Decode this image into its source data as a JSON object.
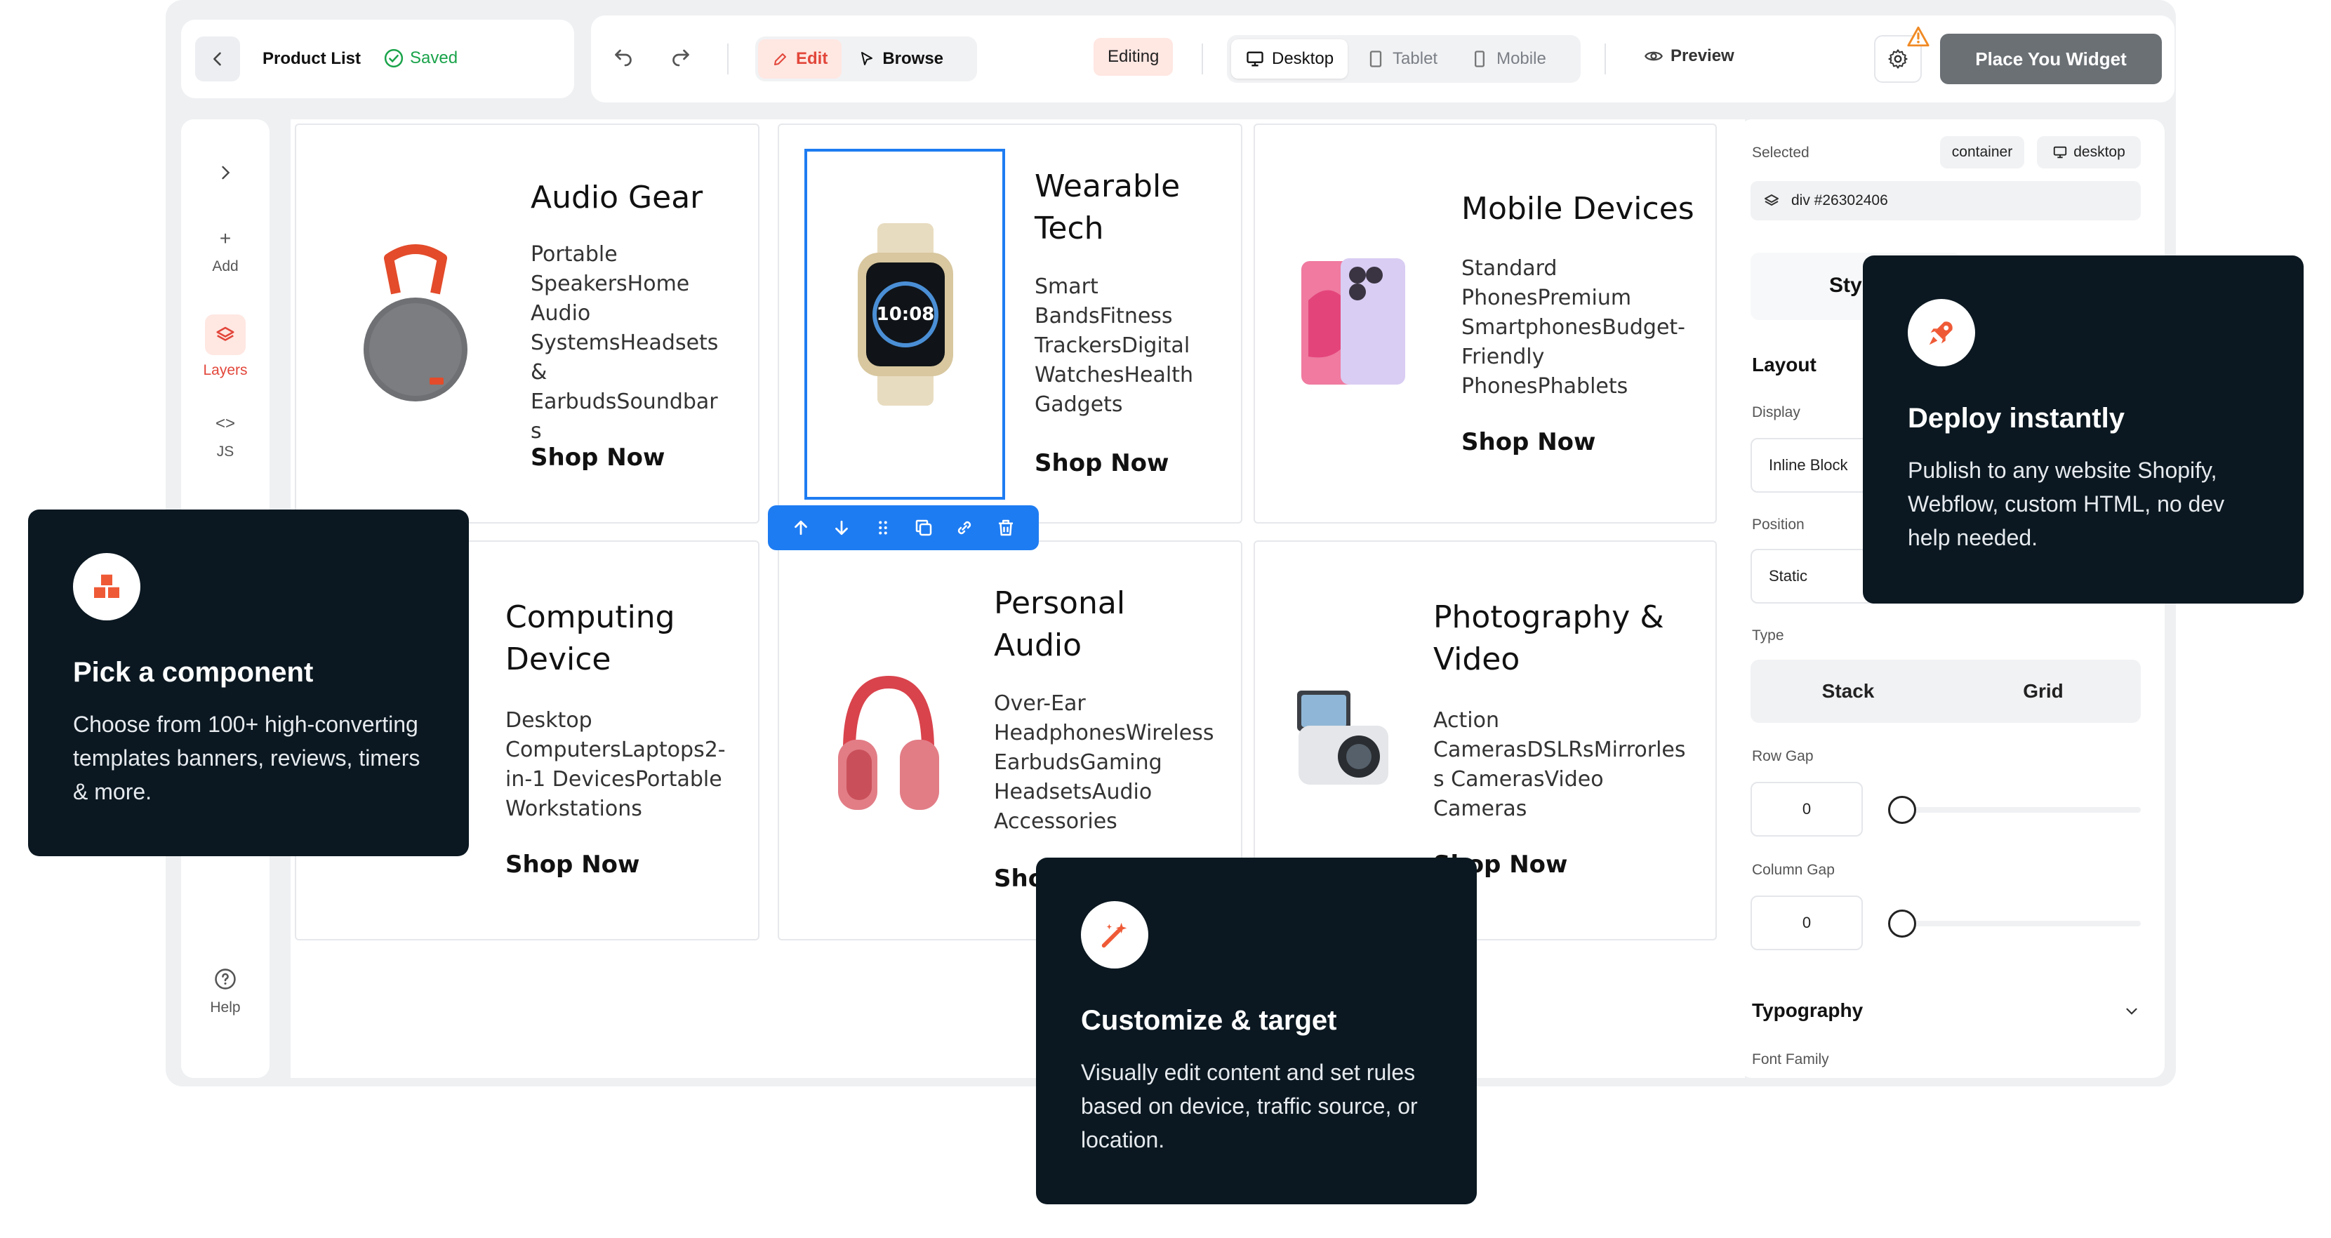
{
  "header": {
    "page_title": "Product List",
    "saved_label": "Saved",
    "edit_label": "Edit",
    "browse_label": "Browse",
    "editing_badge": "Editing",
    "desktop_label": "Desktop",
    "tablet_label": "Tablet",
    "mobile_label": "Mobile",
    "preview_label": "Preview",
    "cta_label": "Place You Widget"
  },
  "rail": {
    "add_label": "Add",
    "layers_label": "Layers",
    "js_label": "JS",
    "help_label": "Help"
  },
  "cards": [
    {
      "title": "Audio Gear",
      "desc": "Portable SpeakersHome Audio SystemsHeadsets & EarbudsSoundbars",
      "cta": "Shop Now"
    },
    {
      "title": "Wearable Tech",
      "desc": "Smart BandsFitness TrackersDigital WatchesHealth Gadgets",
      "cta": "Shop Now"
    },
    {
      "title": "Mobile Devices",
      "desc": "Standard PhonesPremium SmartphonesBudget-Friendly PhonesPhablets",
      "cta": "Shop Now"
    },
    {
      "title": "Computing Device",
      "desc": "Desktop ComputersLaptops2-in-1 DevicesPortable Workstations",
      "cta": "Shop Now"
    },
    {
      "title": "Personal Audio",
      "desc": "Over-Ear HeadphonesWireless EarbudsGaming HeadsetsAudio Accessories",
      "cta": "Shop Now"
    },
    {
      "title": "Photography & Video",
      "desc": "Action CamerasDSLRsMirrorless CamerasVideo Cameras",
      "cta": "Shop Now"
    }
  ],
  "panel": {
    "selected_label": "Selected",
    "container_pill": "container",
    "desktop_pill": "desktop",
    "element_id": "div #26302406",
    "style_tab": "Sty",
    "layout_heading": "Layout",
    "display_label": "Display",
    "display_value": "Inline Block",
    "position_label": "Position",
    "position_value": "Static",
    "type_label": "Type",
    "stack_label": "Stack",
    "grid_label": "Grid",
    "row_gap_label": "Row Gap",
    "row_gap_value": "0",
    "column_gap_label": "Column Gap",
    "column_gap_value": "0",
    "typography_heading": "Typography",
    "font_family_label": "Font Family"
  },
  "tips": {
    "deploy": {
      "title": "Deploy instantly",
      "body": "Publish to any website Shopify, Webflow, custom HTML, no dev help needed."
    },
    "pick": {
      "title": "Pick a component",
      "body": "Choose from 100+ high-converting templates banners, reviews, timers & more."
    },
    "customize": {
      "title": "Customize & target",
      "body": "Visually edit content and set rules based on device, traffic source, or location."
    }
  },
  "colors": {
    "accent_red": "#e2463a",
    "selection_blue": "#1e7cf2",
    "dark_tooltip": "#0b1821",
    "saved_green": "#1aa34a"
  }
}
